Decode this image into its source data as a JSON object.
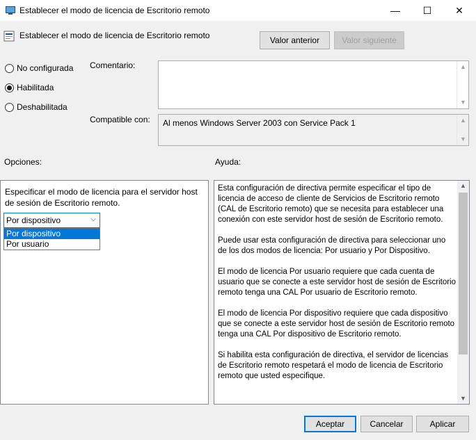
{
  "window": {
    "title": "Establecer el modo de licencia de Escritorio remoto",
    "minimize": "—",
    "maximize": "☐",
    "close": "✕"
  },
  "header": {
    "policy_title": "Establecer el modo de licencia de Escritorio remoto",
    "prev_label": "Valor anterior",
    "next_label": "Valor siguiente"
  },
  "state": {
    "options": [
      {
        "label": "No configurada",
        "checked": false
      },
      {
        "label": "Habilitada",
        "checked": true
      },
      {
        "label": "Deshabilitada",
        "checked": false
      }
    ]
  },
  "comment": {
    "label": "Comentario:",
    "value": ""
  },
  "compatible": {
    "label": "Compatible con:",
    "value": "Al menos Windows Server 2003 con Service Pack 1"
  },
  "options_section": {
    "label": "Opciones:",
    "description": "Especificar el modo de licencia para el servidor host de sesión de Escritorio remoto.",
    "select_value": "Por dispositivo",
    "dropdown_items": [
      "Por dispositivo",
      "Por usuario"
    ]
  },
  "help_section": {
    "label": "Ayuda:",
    "paragraphs": [
      "Esta configuración de directiva permite especificar el tipo de licencia de acceso de cliente de Servicios de Escritorio remoto (CAL de Escritorio remoto) que se necesita para establecer una conexión con este servidor host de sesión de Escritorio remoto.",
      "Puede usar esta configuración de directiva para seleccionar uno de los dos modos de licencia: Por usuario y Por Dispositivo.",
      "El modo de licencia Por usuario requiere que cada cuenta de usuario que se conecte a este servidor host de sesión de Escritorio remoto tenga una CAL Por usuario de Escritorio remoto.",
      "El modo de licencia Por dispositivo requiere que cada dispositivo que se conecte a este servidor host de sesión de Escritorio remoto tenga una CAL Por dispositivo de Escritorio remoto.",
      "Si habilita esta configuración de directiva, el servidor de licencias de Escritorio remoto respetará el modo de licencia de Escritorio remoto que usted especifique."
    ]
  },
  "footer": {
    "ok": "Aceptar",
    "cancel": "Cancelar",
    "apply": "Aplicar"
  },
  "colors": {
    "accent": "#0078d7",
    "window_bg": "#f0f0f0"
  }
}
